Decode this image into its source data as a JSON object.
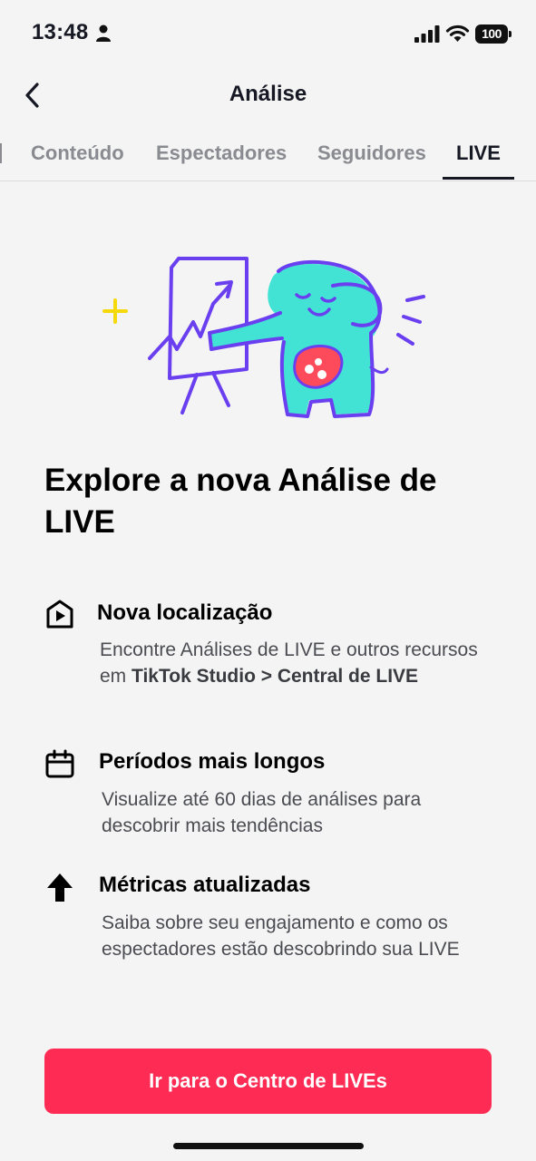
{
  "status_bar": {
    "time": "13:48",
    "battery": "100"
  },
  "header": {
    "title": "Análise"
  },
  "tabs": [
    {
      "label": "Conteúdo",
      "active": false
    },
    {
      "label": "Espectadores",
      "active": false
    },
    {
      "label": "Seguidores",
      "active": false
    },
    {
      "label": "LIVE",
      "active": true
    }
  ],
  "headline": "Explore a nova Análise de LIVE",
  "features": [
    {
      "icon": "play-house-icon",
      "title": "Nova localização",
      "desc_prefix": "Encontre Análises de LIVE e outros recursos em ",
      "desc_bold": "TikTok Studio > Central de LIVE"
    },
    {
      "icon": "calendar-icon",
      "title": "Períodos mais longos",
      "desc": "Visualize até 60 dias de análises para descobrir mais tendências"
    },
    {
      "icon": "arrow-up-icon",
      "title": "Métricas atualizadas",
      "desc": "Saiba sobre seu engajamento e como os espectadores estão descobrindo sua LIVE"
    }
  ],
  "cta": {
    "label": "Ir para o Centro de LIVEs"
  },
  "colors": {
    "accent": "#fe2c55",
    "illustration_purple": "#6a3ff0",
    "illustration_teal": "#42e3d4",
    "illustration_yellow": "#f5d90a"
  }
}
